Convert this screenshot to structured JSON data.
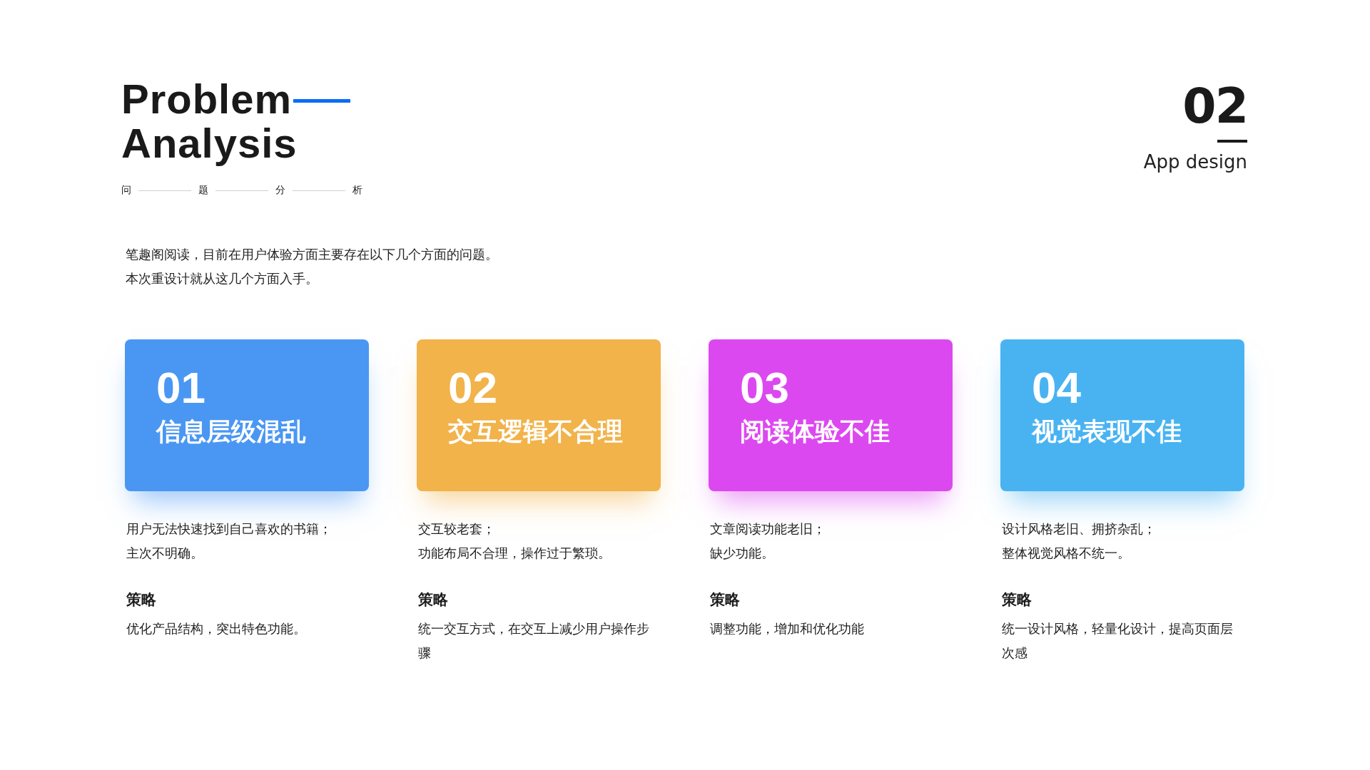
{
  "title": {
    "lines": [
      "Problem",
      "Analysis"
    ],
    "subtitle_chars": [
      "问",
      "题",
      "分",
      "析"
    ]
  },
  "section": {
    "number": "02",
    "label": "App design"
  },
  "intro": [
    "笔趣阁阅读，目前在用户体验方面主要存在以下几个方面的问题。",
    "本次重设计就从这几个方面入手。"
  ],
  "cards": [
    {
      "number": "01",
      "title": "信息层级混乱",
      "color": "#4a97f3",
      "problems": [
        "用户无法快速找到自己喜欢的书籍；",
        "主次不明确。"
      ],
      "strategy_heading": "策略",
      "strategy": "优化产品结构，突出特色功能。"
    },
    {
      "number": "02",
      "title": "交互逻辑不合理",
      "color": "#f1b34a",
      "problems": [
        "交互较老套；",
        "功能布局不合理，操作过于繁琐。"
      ],
      "strategy_heading": "策略",
      "strategy": "统一交互方式，在交互上减少用户操作步骤"
    },
    {
      "number": "03",
      "title": "阅读体验不佳",
      "color": "#dc48f0",
      "problems": [
        "文章阅读功能老旧；",
        "缺少功能。"
      ],
      "strategy_heading": "策略",
      "strategy": "调整功能，增加和优化功能"
    },
    {
      "number": "04",
      "title": "视觉表现不佳",
      "color": "#49b3f2",
      "problems": [
        "设计风格老旧、拥挤杂乱；",
        "整体视觉风格不统一。"
      ],
      "strategy_heading": "策略",
      "strategy": "统一设计风格，轻量化设计，提高页面层次感"
    }
  ]
}
